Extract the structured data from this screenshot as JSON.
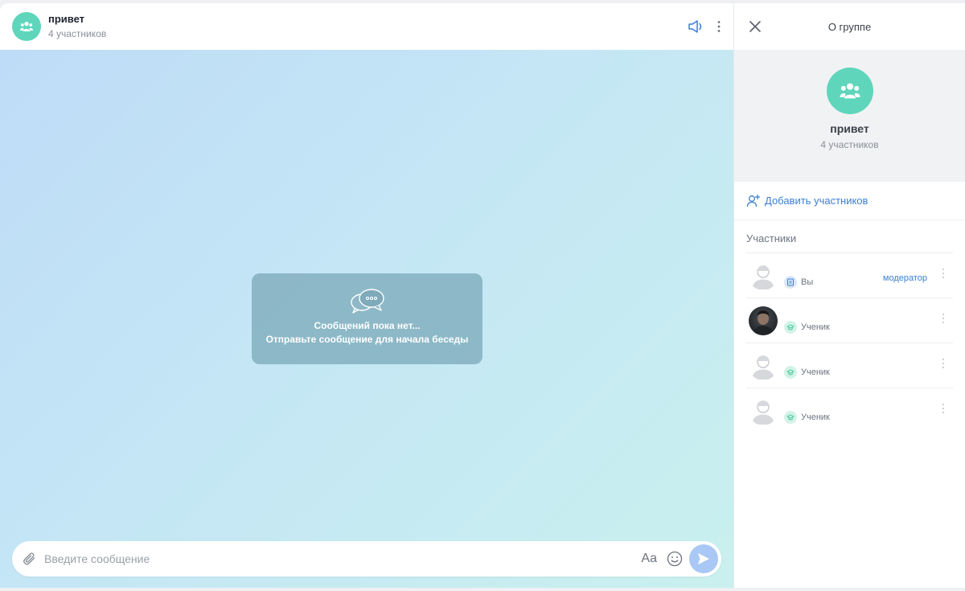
{
  "chat": {
    "title": "привет",
    "subtitle": "4 участников",
    "empty_line1": "Сообщений пока нет...",
    "empty_line2": "Отправьте сообщение для начала беседы",
    "input_placeholder": "Введите сообщение",
    "format_label": "Aa"
  },
  "panel": {
    "title": "О группе",
    "group_name": "привет",
    "group_count": "4 участников",
    "add_members_label": "Добавить участников",
    "members_section_label": "Участники",
    "members": [
      {
        "role_label": "Вы",
        "badge": "модератор",
        "avatar": "placeholder"
      },
      {
        "role_label": "Ученик",
        "avatar": "photo"
      },
      {
        "role_label": "Ученик",
        "avatar": "placeholder"
      },
      {
        "role_label": "Ученик",
        "avatar": "placeholder"
      }
    ]
  },
  "icons": {
    "group": "group-icon",
    "sound": "speaker-icon",
    "more": "more-vertical-icon",
    "close": "close-icon",
    "attach": "paperclip-icon",
    "emoji": "smiley-icon",
    "send": "send-icon",
    "add_user": "add-user-icon",
    "chat_bubbles": "chat-bubbles-icon"
  },
  "colors": {
    "accent_blue": "#3a7fd5",
    "group_avatar": "#5fd6bb",
    "send_button": "#a9c8f5"
  }
}
